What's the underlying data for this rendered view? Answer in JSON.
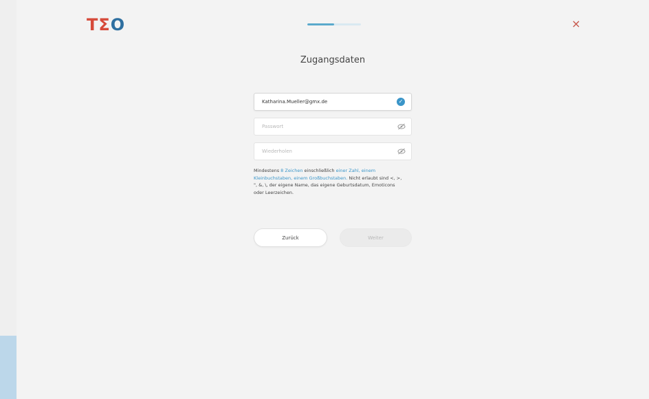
{
  "logo": {
    "t": "T",
    "s": "Σ",
    "o": "O"
  },
  "progress": {
    "fraction": 0.5
  },
  "header": {
    "close_label": "×"
  },
  "title": "Zugangsdaten",
  "fields": {
    "email": {
      "value": "Katharina.Mueller@gmx.de",
      "valid": true
    },
    "password": {
      "placeholder": "Passwort",
      "value": ""
    },
    "repeat": {
      "placeholder": "Wiederholen",
      "value": ""
    }
  },
  "hint": {
    "p1": "Mindestens ",
    "l1": "8 Zeichen",
    "p2": " einschließlich ",
    "l2": "einer Zahl, einem Kleinbuchstaben, einem Großbuchstaben.",
    "p3": " Nicht erlaubt sind <, >, \", &, \\, der eigene Name, das eigene Geburtsdatum, Emoticons oder Leerzeichen."
  },
  "buttons": {
    "back": "Zurück",
    "next": "Weiter"
  },
  "colors": {
    "accent": "#3a95c8",
    "logo_red": "#d64a3a",
    "logo_blue": "#2e6fa0",
    "close": "#c65347"
  }
}
